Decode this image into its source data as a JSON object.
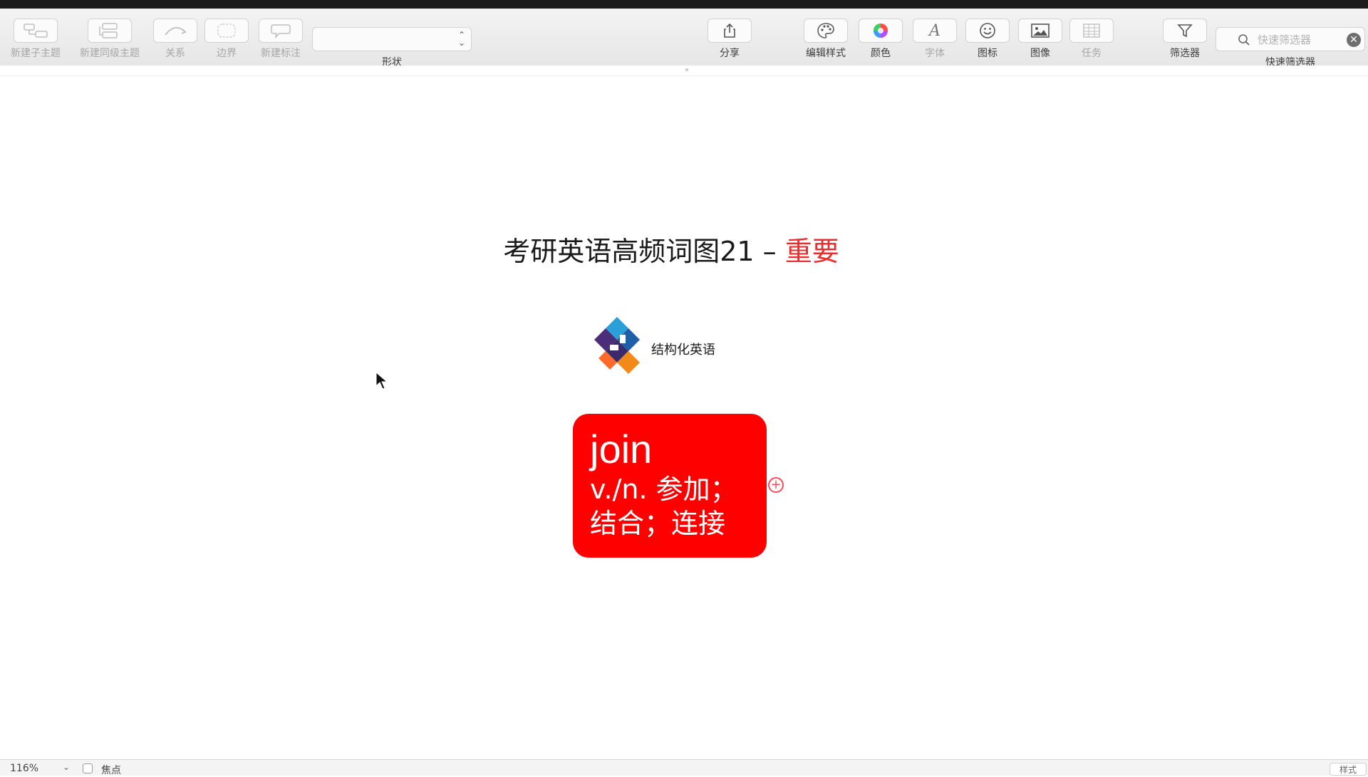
{
  "toolbar": {
    "new_subtopic": "新建子主题",
    "new_sibling": "新建同级主题",
    "relationship": "关系",
    "boundary": "边界",
    "new_callout": "新建标注",
    "shape_value": "",
    "shape_label": "形状",
    "share": "分享",
    "edit_style": "编辑样式",
    "color": "颜色",
    "font": "字体",
    "icon": "图标",
    "image": "图像",
    "task": "任务",
    "filter": "筛选器",
    "quick_filter_placeholder": "快速筛选器",
    "quick_filter_label": "快速筛选器"
  },
  "canvas": {
    "title_main": "考研英语高频词图21 – ",
    "title_highlight": "重要",
    "logo_text": "结构化英语",
    "topic": {
      "word": "join",
      "meaning_line1": "v./n. 参加；",
      "meaning_line2": "结合；连接"
    }
  },
  "statusbar": {
    "zoom": "116%",
    "focus_label": "焦点",
    "style_button": "样式"
  },
  "colors": {
    "topic_fill": "#ff0000",
    "title_highlight": "#ee2b2b",
    "toolbar_bg": "#ececec"
  }
}
